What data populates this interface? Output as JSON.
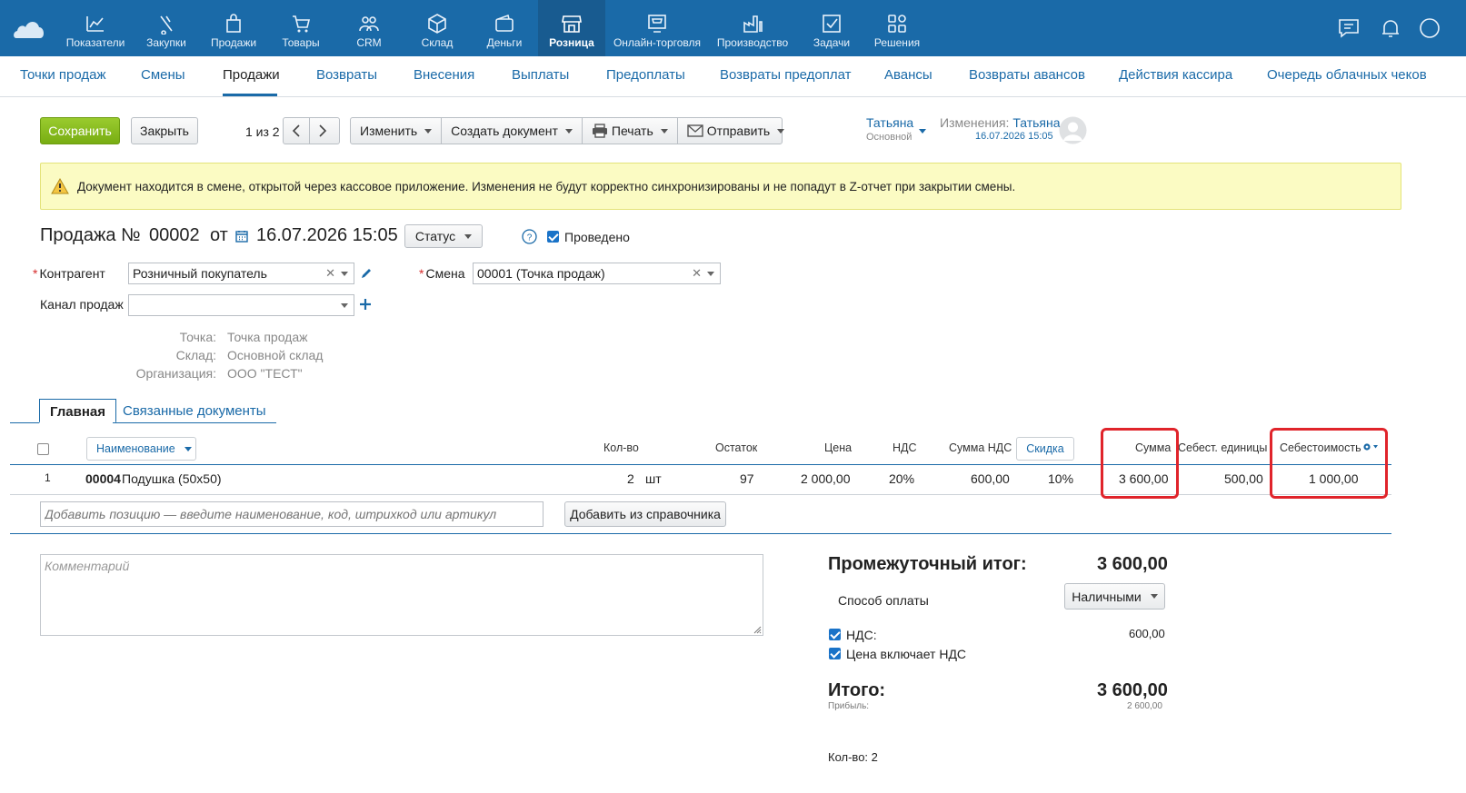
{
  "topnav": {
    "items": [
      {
        "label": "Показатели",
        "icon": "chart-line-icon"
      },
      {
        "label": "Закупки",
        "icon": "purchase-bag-icon"
      },
      {
        "label": "Продажи",
        "icon": "shopping-bag-icon"
      },
      {
        "label": "Товары",
        "icon": "cart-icon"
      },
      {
        "label": "CRM",
        "icon": "users-icon"
      },
      {
        "label": "Склад",
        "icon": "box-icon"
      },
      {
        "label": "Деньги",
        "icon": "wallet-icon"
      },
      {
        "label": "Розница",
        "icon": "store-icon"
      },
      {
        "label": "Онлайн-торговля",
        "icon": "online-store-icon"
      },
      {
        "label": "Производство",
        "icon": "factory-icon"
      },
      {
        "label": "Задачи",
        "icon": "task-check-icon"
      },
      {
        "label": "Решения",
        "icon": "apps-grid-icon"
      }
    ],
    "active": "Розница"
  },
  "subnav": {
    "items": [
      "Точки продаж",
      "Смены",
      "Продажи",
      "Возвраты",
      "Внесения",
      "Выплаты",
      "Предоплаты",
      "Возвраты предоплат",
      "Авансы",
      "Возвраты авансов",
      "Действия кассира",
      "Очередь облачных чеков"
    ],
    "active": "Продажи"
  },
  "toolbar": {
    "save": "Сохранить",
    "close": "Закрыть",
    "pager": "1 из 2",
    "change": "Изменить",
    "create_doc": "Создать документ",
    "print": "Печать",
    "send": "Отправить",
    "user_name": "Татьяна",
    "user_role": "Основной",
    "changes_label": "Изменения:",
    "changes_user": "Татьяна",
    "changes_date": "16.07.2026 15:05"
  },
  "warning": "Документ находится в смене, открытой через кассовое приложение. Изменения не будут корректно синхронизированы и не попадут в Z-отчет при закрытии смены.",
  "doc": {
    "title_prefix": "Продажа №",
    "number": "00002",
    "from": "от",
    "date": "16.07.2026 15:05",
    "status": "Статус",
    "posted": "Проведено"
  },
  "form": {
    "counterparty_label": "Контрагент",
    "counterparty_value": "Розничный покупатель",
    "shift_label": "Смена",
    "shift_value": "00001 (Точка продаж)",
    "channel_label": "Канал продаж",
    "channel_value": "",
    "point_label": "Точка:",
    "point_value": "Точка продаж",
    "warehouse_label": "Склад:",
    "warehouse_value": "Основной склад",
    "org_label": "Организация:",
    "org_value": "ООО \"ТЕСТ\""
  },
  "tabs": {
    "main": "Главная",
    "related": "Связанные документы"
  },
  "table": {
    "headers": {
      "name": "Наименование",
      "qty": "Кол-во",
      "stock": "Остаток",
      "price": "Цена",
      "vat": "НДС",
      "vat_sum": "Сумма НДС",
      "discount": "Скидка",
      "sum": "Сумма",
      "unit_cost": "Себест. единицы",
      "cost": "Себестоимость"
    },
    "rows": [
      {
        "n": "1",
        "code": "00004",
        "name": "Подушка (50x50)",
        "qty": "2",
        "unit": "шт",
        "stock": "97",
        "price": "2 000,00",
        "vat": "20%",
        "vat_sum": "600,00",
        "discount": "10%",
        "sum": "3 600,00",
        "unit_cost": "500,00",
        "cost": "1 000,00"
      }
    ],
    "add_placeholder": "Добавить позицию — введите наименование, код, штрихкод или артикул",
    "add_from_catalog": "Добавить из справочника"
  },
  "comment_placeholder": "Комментарий",
  "totals": {
    "subtotal_label": "Промежуточный итог:",
    "subtotal": "3 600,00",
    "payment_label": "Способ оплаты",
    "payment_value": "Наличными",
    "vat_label": "НДС:",
    "vat_value": "600,00",
    "vat_included": "Цена включает НДС",
    "total_label": "Итого:",
    "total": "3 600,00",
    "profit_label": "Прибыль:",
    "profit": "2 600,00",
    "qty_label": "Кол-во: 2"
  }
}
